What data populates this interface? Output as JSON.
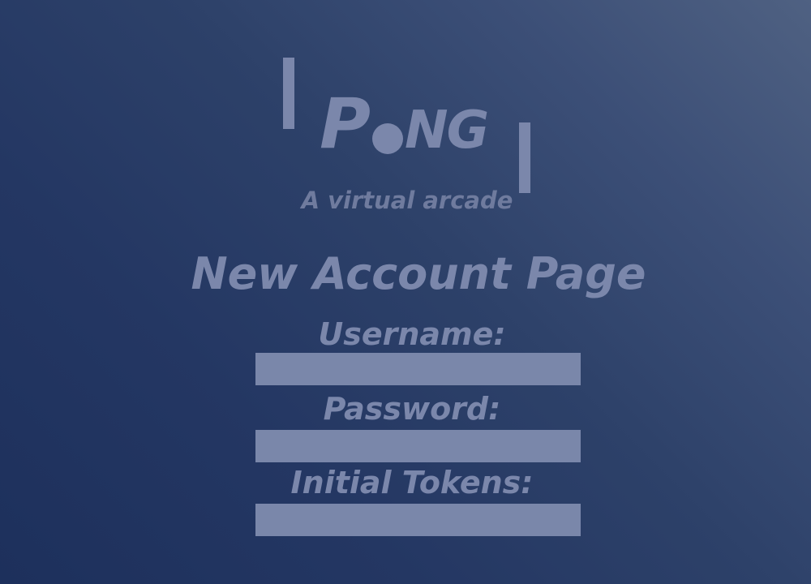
{
  "logo": {
    "first_letter": "P",
    "rest_letters": "NG"
  },
  "tagline": "A virtual arcade",
  "page_title": "New Account Page",
  "form": {
    "username": {
      "label": "Username:",
      "value": ""
    },
    "password": {
      "label": "Password:",
      "value": ""
    },
    "initial_tokens": {
      "label": "Initial Tokens:",
      "value": ""
    }
  },
  "colors": {
    "background_dark": "#1d305c",
    "background_light": "#4f6182",
    "foreground": "#7b87ab",
    "input_fill": "#7a87aa"
  }
}
